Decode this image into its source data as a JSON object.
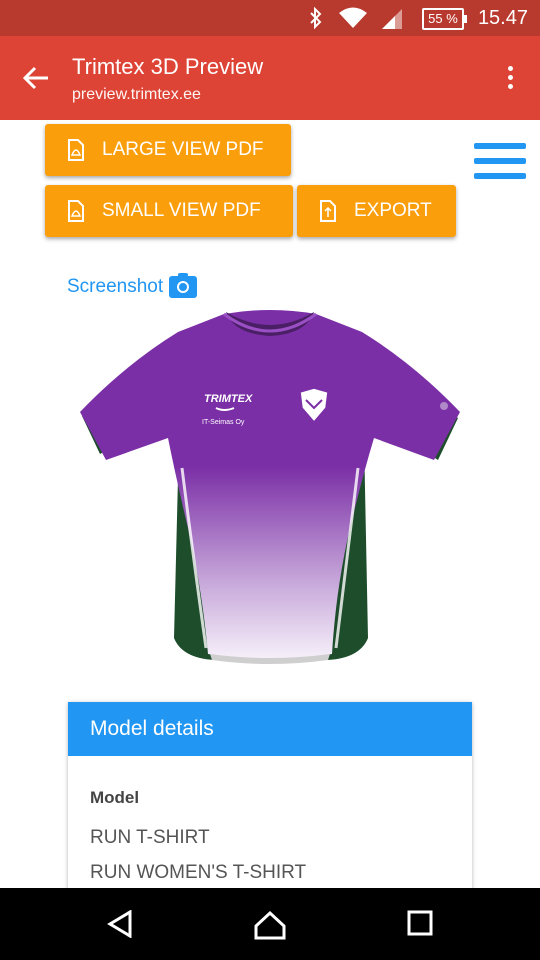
{
  "status_bar": {
    "battery": "55 %",
    "time": "15.47"
  },
  "app_bar": {
    "title": "Trimtex 3D Preview",
    "url": "preview.trimtex.ee"
  },
  "buttons": {
    "large_pdf": "LARGE VIEW PDF",
    "small_pdf": "SMALL VIEW PDF",
    "export": "EXPORT"
  },
  "screenshot": {
    "label": "Screenshot"
  },
  "shirt": {
    "brand": "TRIMTEX",
    "sponsor": "IT-Seimas Oy"
  },
  "model_details": {
    "title": "Model details",
    "label": "Model",
    "items": [
      "RUN T-SHIRT",
      "RUN WOMEN'S T-SHIRT"
    ]
  },
  "colors": {
    "app_bar": "#dd4436",
    "status_bar": "#b8392d",
    "button": "#fb9e0c",
    "accent": "#2196f3",
    "shirt_purple": "#7b2fa6",
    "shirt_green": "#1d4d2b"
  }
}
